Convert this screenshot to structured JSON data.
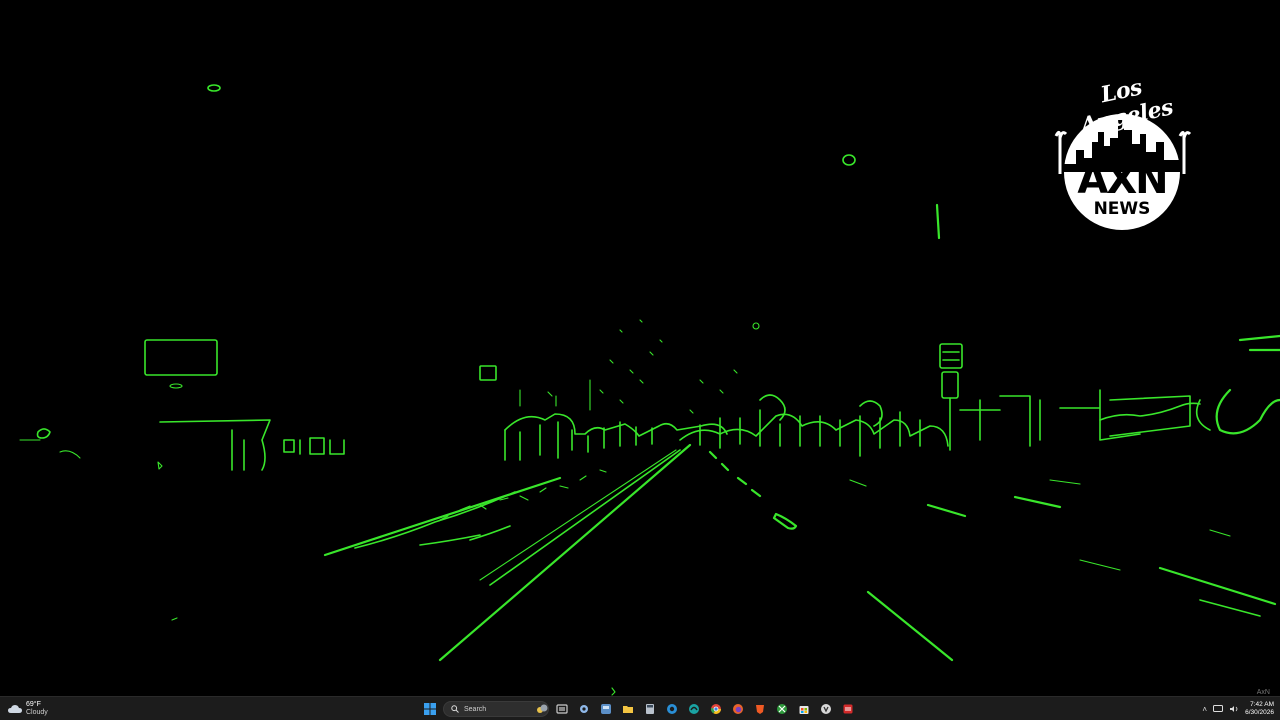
{
  "wallpaper": {
    "description_icon": "edge-detection-road-night",
    "edge_color": "#39e62b",
    "background_color": "#000000"
  },
  "logo": {
    "script_text": "Los Angeles",
    "main_text": "AXN",
    "sub_text": "NEWS"
  },
  "corner_mark": "AxN",
  "taskbar": {
    "weather": {
      "temperature": "69°F",
      "condition": "Cloudy",
      "icon": "cloud-icon"
    },
    "search": {
      "placeholder": "Search"
    },
    "pinned_apps": [
      {
        "name": "task-view-icon"
      },
      {
        "name": "settings-icon"
      },
      {
        "name": "widgets-icon"
      },
      {
        "name": "file-explorer-icon"
      },
      {
        "name": "calculator-icon"
      },
      {
        "name": "edge-icon-1"
      },
      {
        "name": "edge-icon-2"
      },
      {
        "name": "chrome-icon"
      },
      {
        "name": "firefox-icon"
      },
      {
        "name": "brave-icon"
      },
      {
        "name": "xbox-icon"
      },
      {
        "name": "store-icon"
      },
      {
        "name": "unknown-app-icon"
      },
      {
        "name": "red-app-icon"
      }
    ],
    "clock": {
      "time": "7:42 AM",
      "date": "6/30/2026"
    }
  }
}
